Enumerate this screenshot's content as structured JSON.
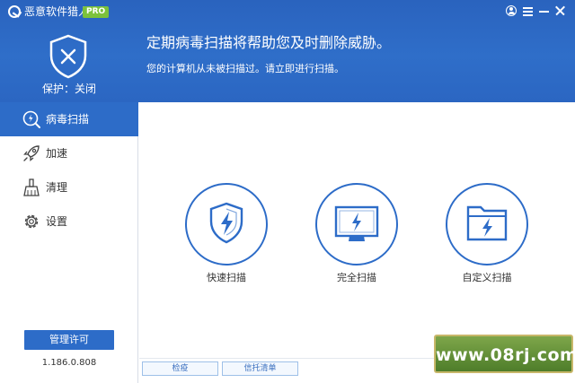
{
  "window": {
    "title": "恶意软件猎人",
    "badge": "PRO"
  },
  "status": {
    "protection_label": "保护：关闭",
    "headline": "定期病毒扫描将帮助您及时删除威胁。",
    "subline": "您的计算机从未被扫描过。请立即进行扫描。"
  },
  "sidebar": {
    "items": [
      {
        "label": "病毒扫描",
        "icon": "virus-scan-icon",
        "active": true
      },
      {
        "label": "加速",
        "icon": "rocket-icon",
        "active": false
      },
      {
        "label": "清理",
        "icon": "broom-icon",
        "active": false
      },
      {
        "label": "设置",
        "icon": "gear-icon",
        "active": false
      }
    ],
    "license_button": "管理许可",
    "version": "1.186.0.808"
  },
  "scan_options": [
    {
      "label": "快速扫描",
      "icon": "shield-bolt-icon"
    },
    {
      "label": "完全扫描",
      "icon": "monitor-bolt-icon"
    },
    {
      "label": "自定义扫描",
      "icon": "folder-bolt-icon"
    }
  ],
  "bottom_bar": {
    "quarantine": "检疫",
    "trust_list": "信托清单"
  },
  "watermark": "www.08rj.com",
  "colors": {
    "header_blue": "#2f6ec9",
    "accent_blue": "#2d6cc8",
    "pro_green": "#7cc23b",
    "icon_blue": "#2d6cc8"
  }
}
